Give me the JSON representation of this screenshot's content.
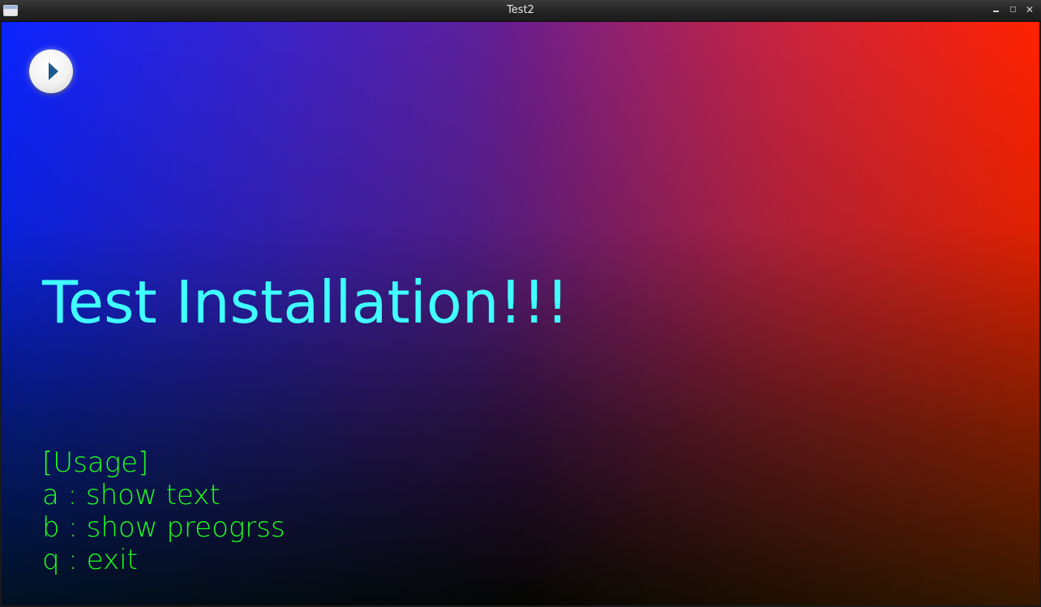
{
  "window": {
    "title": "Test2",
    "controls": {
      "minimize": "minimize",
      "maximize": "maximize",
      "close": "close"
    }
  },
  "content": {
    "play_button_icon": "play-icon",
    "headline": "Test Installation!!!",
    "usage": [
      "[Usage]",
      "a : show text",
      "b : show preogrss",
      "q : exit"
    ],
    "colors": {
      "headline": "#40ffff",
      "usage": "#20ff20",
      "gradient_left": "#0a14ff",
      "gradient_right": "#ff0a00",
      "gradient_bottom": "#000000"
    }
  }
}
